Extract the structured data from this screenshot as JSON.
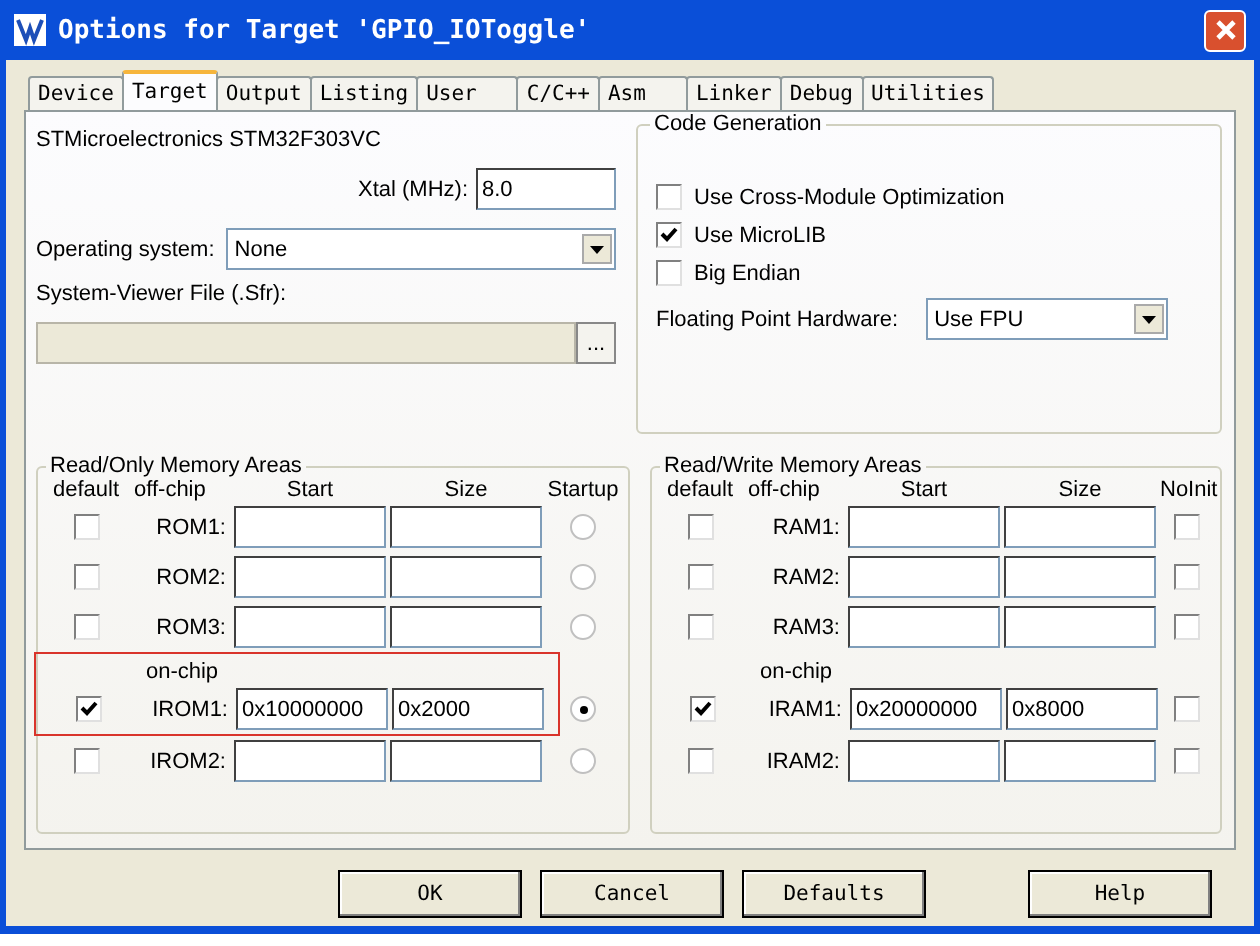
{
  "window": {
    "title": "Options for Target 'GPIO_IOToggle'"
  },
  "tabs": [
    {
      "label": "Device",
      "selected": false
    },
    {
      "label": "Target",
      "selected": true
    },
    {
      "label": "Output",
      "selected": false
    },
    {
      "label": "Listing",
      "selected": false
    },
    {
      "label": "User",
      "selected": false
    },
    {
      "label": "C/C++",
      "selected": false
    },
    {
      "label": "Asm",
      "selected": false
    },
    {
      "label": "Linker",
      "selected": false
    },
    {
      "label": "Debug",
      "selected": false
    },
    {
      "label": "Utilities",
      "selected": false
    }
  ],
  "device": "STMicroelectronics STM32F303VC",
  "xtal": {
    "label": "Xtal (MHz):",
    "value": "8.0"
  },
  "operating_system": {
    "label": "Operating system:",
    "value": "None"
  },
  "system_viewer_file": {
    "label": "System-Viewer File (.Sfr):",
    "browse": "..."
  },
  "code_generation": {
    "title": "Code Generation",
    "options": [
      {
        "label": "Use Cross-Module Optimization",
        "checked": false
      },
      {
        "label": "Use MicroLIB",
        "checked": true
      },
      {
        "label": "Big Endian",
        "checked": false
      }
    ],
    "fpu": {
      "label": "Floating Point Hardware:",
      "value": "Use FPU"
    }
  },
  "rom_areas": {
    "title": "Read/Only Memory Areas",
    "columns": [
      "default",
      "off-chip",
      "Start",
      "Size",
      "Startup"
    ],
    "rows": [
      {
        "kind": "row",
        "label": "ROM1:",
        "default": false,
        "start": "",
        "size": "",
        "startup": false
      },
      {
        "kind": "row",
        "label": "ROM2:",
        "default": false,
        "start": "",
        "size": "",
        "startup": false
      },
      {
        "kind": "row",
        "label": "ROM3:",
        "default": false,
        "start": "",
        "size": "",
        "startup": false
      },
      {
        "kind": "heading",
        "label": "on-chip",
        "highlighted": true
      },
      {
        "kind": "row",
        "label": "IROM1:",
        "default": true,
        "start": "0x10000000",
        "size": "0x2000",
        "startup": true
      },
      {
        "kind": "row",
        "label": "IROM2:",
        "default": false,
        "start": "",
        "size": "",
        "startup": false
      }
    ]
  },
  "ram_areas": {
    "title": "Read/Write Memory Areas",
    "columns": [
      "default",
      "off-chip",
      "Start",
      "Size",
      "NoInit"
    ],
    "rows": [
      {
        "kind": "row",
        "label": "RAM1:",
        "default": false,
        "start": "",
        "size": "",
        "noinit": false
      },
      {
        "kind": "row",
        "label": "RAM2:",
        "default": false,
        "start": "",
        "size": "",
        "noinit": false
      },
      {
        "kind": "row",
        "label": "RAM3:",
        "default": false,
        "start": "",
        "size": "",
        "noinit": false
      },
      {
        "kind": "heading",
        "label": "on-chip",
        "highlighted": false
      },
      {
        "kind": "row",
        "label": "IRAM1:",
        "default": true,
        "start": "0x20000000",
        "size": "0x8000",
        "noinit": false
      },
      {
        "kind": "row",
        "label": "IRAM2:",
        "default": false,
        "start": "",
        "size": "",
        "noinit": false
      }
    ]
  },
  "buttons": [
    "OK",
    "Cancel",
    "Defaults",
    "Help"
  ]
}
